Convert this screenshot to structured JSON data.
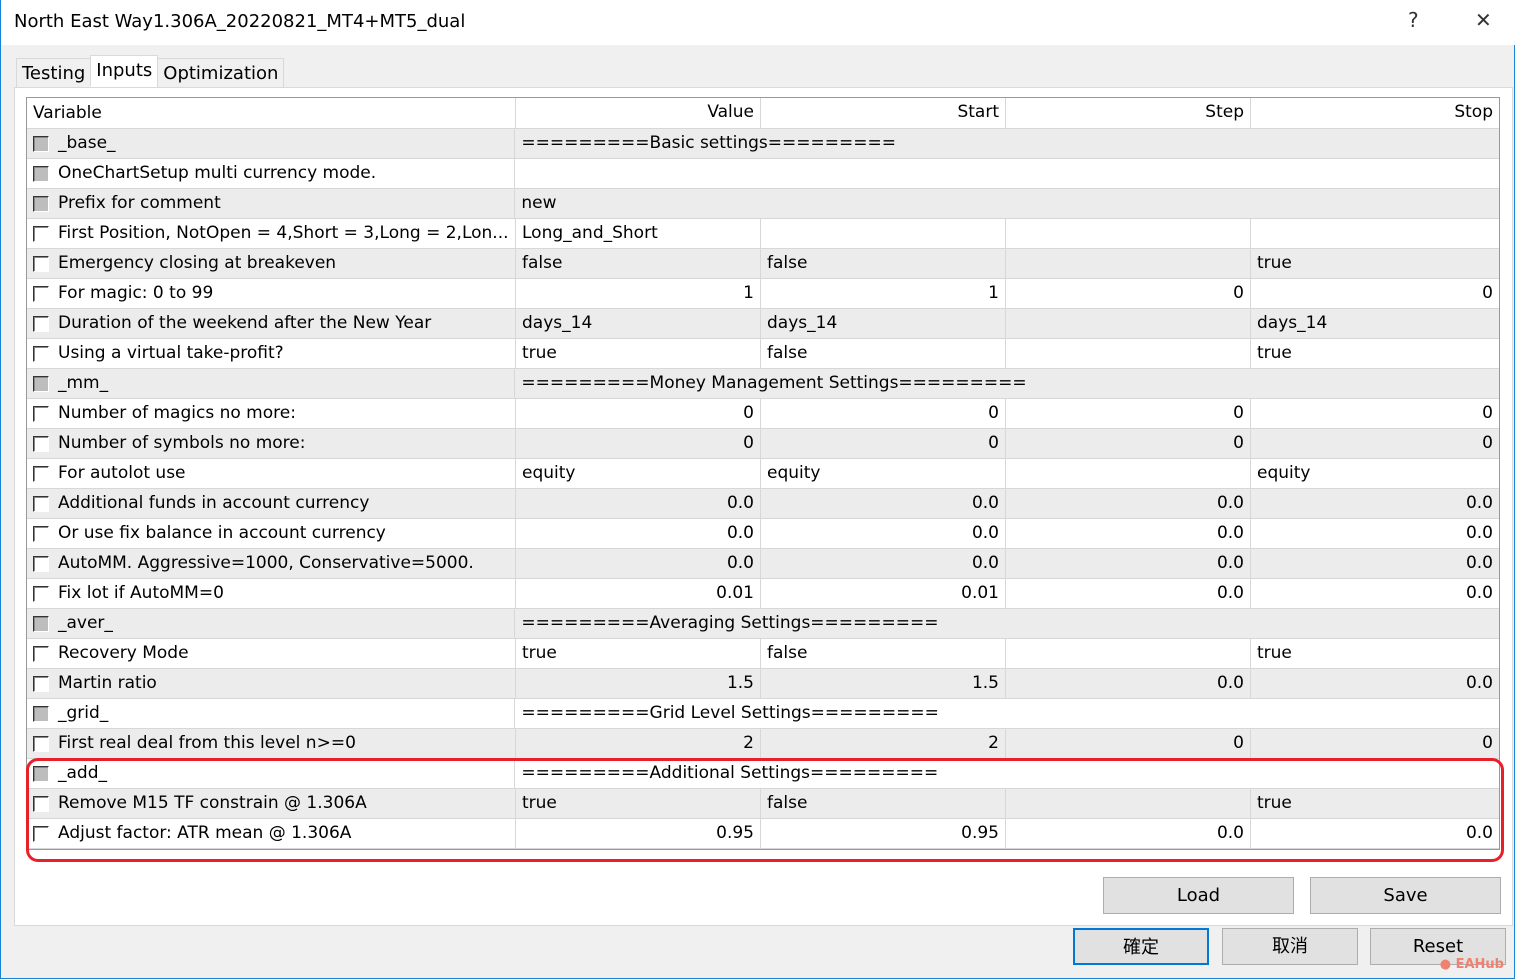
{
  "window": {
    "title": "North East Way1.306A_20220821_MT4+MT5_dual",
    "help": "?",
    "close": "✕"
  },
  "tabs": [
    {
      "label": "Testing"
    },
    {
      "label": "Inputs"
    },
    {
      "label": "Optimization"
    }
  ],
  "headers": {
    "variable": "Variable",
    "value": "Value",
    "start": "Start",
    "step": "Step",
    "stop": "Stop"
  },
  "rows": [
    {
      "group": true,
      "var": "_base_",
      "span": "=========Basic settings========="
    },
    {
      "group": true,
      "var": "OneChartSetup multi currency mode.",
      "span": ""
    },
    {
      "group": true,
      "var": "Prefix for comment",
      "span": "new"
    },
    {
      "var": "First Position, NotOpen = 4,Short = 3,Long = 2,Lon...",
      "value": "Long_and_Short",
      "start": "",
      "step": "",
      "stop": ""
    },
    {
      "var": "Emergency closing at breakeven",
      "value": "false",
      "start": "false",
      "step": "",
      "stop": "true"
    },
    {
      "var": "For magic: 0 to 99",
      "value": "1",
      "start": "1",
      "step": "0",
      "stop": "0",
      "num": true
    },
    {
      "var": "Duration of the weekend after the New Year",
      "value": "days_14",
      "start": "days_14",
      "step": "",
      "stop": "days_14"
    },
    {
      "var": "Using a virtual take-profit?",
      "value": "true",
      "start": "false",
      "step": "",
      "stop": "true"
    },
    {
      "group": true,
      "var": "_mm_",
      "span": "=========Money Management Settings========="
    },
    {
      "var": "Number of magics no more:",
      "value": "0",
      "start": "0",
      "step": "0",
      "stop": "0",
      "num": true
    },
    {
      "var": "Number of symbols no more:",
      "value": "0",
      "start": "0",
      "step": "0",
      "stop": "0",
      "num": true
    },
    {
      "var": "For autolot use",
      "value": "equity",
      "start": "equity",
      "step": "",
      "stop": "equity"
    },
    {
      "var": "Additional funds in account currency",
      "value": "0.0",
      "start": "0.0",
      "step": "0.0",
      "stop": "0.0",
      "num": true
    },
    {
      "var": "Or use fix balance in account currency",
      "value": "0.0",
      "start": "0.0",
      "step": "0.0",
      "stop": "0.0",
      "num": true
    },
    {
      "var": "AutoMM. Aggressive=1000, Conservative=5000.",
      "value": "0.0",
      "start": "0.0",
      "step": "0.0",
      "stop": "0.0",
      "num": true
    },
    {
      "var": "Fix lot if AutoMM=0",
      "value": "0.01",
      "start": "0.01",
      "step": "0.0",
      "stop": "0.0",
      "num": true
    },
    {
      "group": true,
      "var": "_aver_",
      "span": "=========Averaging Settings========="
    },
    {
      "var": "Recovery Mode",
      "value": "true",
      "start": "false",
      "step": "",
      "stop": "true"
    },
    {
      "var": "Martin ratio",
      "value": "1.5",
      "start": "1.5",
      "step": "0.0",
      "stop": "0.0",
      "num": true
    },
    {
      "group": true,
      "var": "_grid_",
      "span": "=========Grid Level Settings========="
    },
    {
      "var": "First real deal from this level n>=0",
      "value": "2",
      "start": "2",
      "step": "0",
      "stop": "0",
      "num": true
    },
    {
      "group": true,
      "var": "_add_",
      "span": "=========Additional Settings========="
    },
    {
      "var": "Remove M15 TF constrain @ 1.306A",
      "value": "true",
      "start": "false",
      "step": "",
      "stop": "true"
    },
    {
      "var": "Adjust factor: ATR mean @ 1.306A",
      "value": "0.95",
      "start": "0.95",
      "step": "0.0",
      "stop": "0.0",
      "num": true
    }
  ],
  "buttons": {
    "load": "Load",
    "save": "Save",
    "ok": "確定",
    "cancel": "取消",
    "reset": "Reset"
  },
  "watermark": "EAHub"
}
